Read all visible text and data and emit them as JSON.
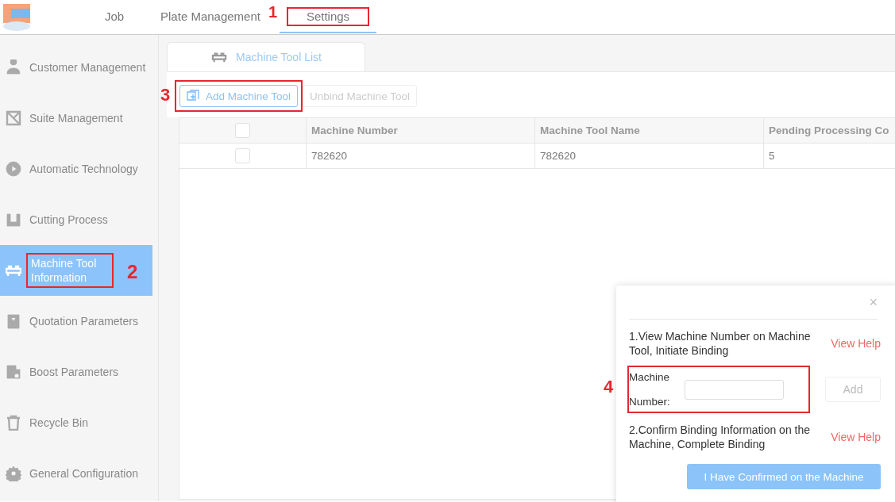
{
  "top_nav": {
    "tabs": [
      {
        "label": "Job",
        "selected": false
      },
      {
        "label": "Plate Management",
        "selected": false
      },
      {
        "label": "Settings",
        "selected": true,
        "callout": "1"
      }
    ]
  },
  "sidebar": {
    "items": [
      {
        "label": "Customer Management",
        "selected": false
      },
      {
        "label": "Suite Management",
        "selected": false
      },
      {
        "label": "Automatic Technology",
        "selected": false
      },
      {
        "label": "Cutting Process",
        "selected": false
      },
      {
        "label": "Machine Tool Information",
        "selected": true,
        "callout": "2"
      },
      {
        "label": "Quotation Parameters",
        "selected": false
      },
      {
        "label": "Boost Parameters",
        "selected": false
      },
      {
        "label": "Recycle Bin",
        "selected": false
      },
      {
        "label": "General Configuration",
        "selected": false
      }
    ]
  },
  "content_tab": {
    "label": "Machine Tool List"
  },
  "toolbar": {
    "buttons": [
      {
        "label": "Add Machine Tool",
        "disabled": false,
        "callout": "3"
      },
      {
        "label": "Unbind Machine Tool",
        "disabled": true
      }
    ]
  },
  "table": {
    "columns": [
      "Machine Number",
      "Machine Tool Name",
      "Pending Processing Co"
    ],
    "rows": [
      {
        "checked": false,
        "cells": [
          "782620",
          "782620",
          "5"
        ]
      }
    ],
    "header_checked": false
  },
  "popup": {
    "step_1": "1.View Machine Number on Machine Tool, Initiate Binding",
    "help_1": "View Help",
    "field_label": "Machine Number:",
    "field_callout": "4",
    "add_button": "Add",
    "add_disabled": true,
    "step_2": "2.Confirm Binding Information on the Machine, Complete Binding",
    "help_2": "View Help",
    "confirm_button": "I Have Confirmed on the Machine",
    "confirm_disabled": true,
    "close": "×"
  }
}
